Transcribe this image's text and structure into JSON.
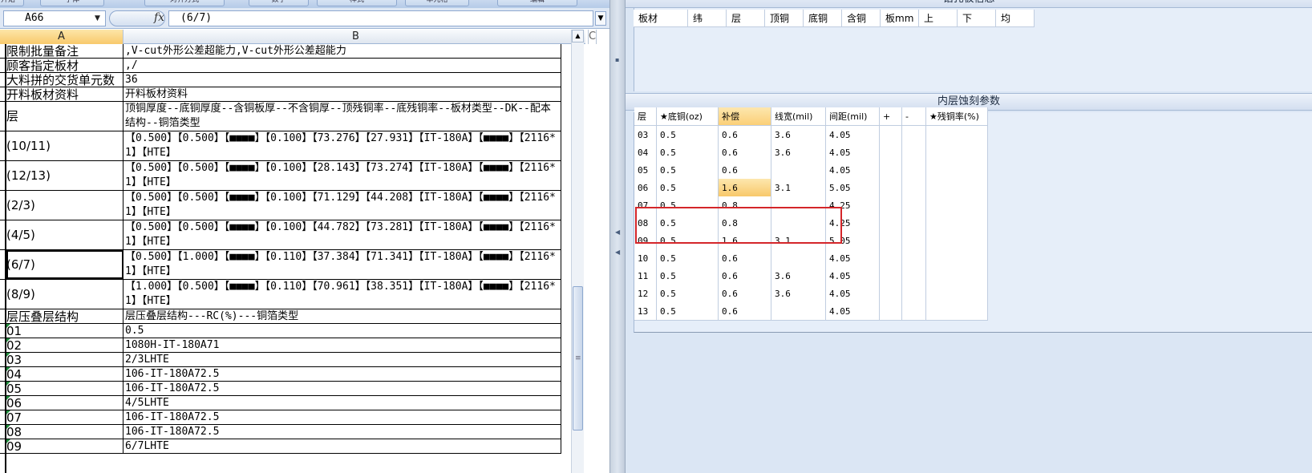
{
  "ribbon": {
    "tabs": [
      "开始",
      "字体",
      "对齐方式",
      "数字",
      "样式",
      "单元格",
      "编辑"
    ]
  },
  "formula_bar": {
    "name_box": "A66",
    "fx": "fx",
    "value": "(6/7)"
  },
  "columns": {
    "a": "A",
    "b": "B",
    "c": "C"
  },
  "sheet_rows": [
    {
      "a": "限制批量备注",
      "b": ",V-cut外形公差超能力,V-cut外形公差超能力"
    },
    {
      "a": "顾客指定板材",
      "b": ",/"
    },
    {
      "a": "大料拼的交货单元数",
      "b": "36"
    },
    {
      "a": "开料板材资料",
      "b": "开料板材资料"
    },
    {
      "a": "层",
      "b": "顶铜厚度--底铜厚度--含铜板厚--不含铜厚--顶残铜率--底残铜率--板材类型--DK--配本结构--铜箔类型"
    },
    {
      "a": "(10/11)",
      "b": "【0.500】【0.500】【■■■■】【0.100】【73.276】【27.931】【IT-180A】【■■■■】【2116*1】【HTE】"
    },
    {
      "a": "(12/13)",
      "b": "【0.500】【0.500】【■■■■】【0.100】【28.143】【73.274】【IT-180A】【■■■■】【2116*1】【HTE】"
    },
    {
      "a": "(2/3)",
      "b": "【0.500】【0.500】【■■■■】【0.100】【71.129】【44.208】【IT-180A】【■■■■】【2116*1】【HTE】"
    },
    {
      "a": "(4/5)",
      "b": "【0.500】【0.500】【■■■■】【0.100】【44.782】【73.281】【IT-180A】【■■■■】【2116*1】【HTE】"
    },
    {
      "a": "(6/7)",
      "b": "【0.500】【1.000】【■■■■】【0.110】【37.384】【71.341】【IT-180A】【■■■■】【2116*1】【HTE】"
    },
    {
      "a": "(8/9)",
      "b": "【1.000】【0.500】【■■■■】【0.110】【70.961】【38.351】【IT-180A】【■■■■】【2116*1】【HTE】"
    },
    {
      "a": "层压叠层结构",
      "b": "层压叠层结构---RC(%)---铜箔类型"
    },
    {
      "a": "01",
      "b": "0.5"
    },
    {
      "a": "02",
      "b": "1080H-IT-180A71"
    },
    {
      "a": "03",
      "b": "2/3LHTE"
    },
    {
      "a": "04",
      "b": "106-IT-180A72.5"
    },
    {
      "a": "05",
      "b": "106-IT-180A72.5"
    },
    {
      "a": "06",
      "b": "4/5LHTE"
    },
    {
      "a": "07",
      "b": "106-IT-180A72.5"
    },
    {
      "a": "08",
      "b": "106-IT-180A72.5"
    },
    {
      "a": "09",
      "b": "6/7LHTE"
    }
  ],
  "top_panel": {
    "title": "钻孔板信息",
    "headers": [
      "板材",
      "纬",
      "层",
      "顶铜",
      "底铜",
      "含铜",
      "板mm",
      "上",
      "下",
      "均"
    ]
  },
  "inner_panel": {
    "title": "内层蚀刻参数",
    "headers": [
      "层",
      "★底铜(oz)",
      "补偿",
      "线宽(mil)",
      "间距(mil)",
      "+",
      "-",
      "★残铜率(%)"
    ],
    "rows": [
      [
        "03",
        "0.5",
        "0.6",
        "3.6",
        "4.05",
        "",
        "",
        ""
      ],
      [
        "04",
        "0.5",
        "0.6",
        "3.6",
        "4.05",
        "",
        "",
        ""
      ],
      [
        "05",
        "0.5",
        "0.6",
        "",
        "4.05",
        "",
        "",
        ""
      ],
      [
        "06",
        "0.5",
        "1.6",
        "3.1",
        "5.05",
        "",
        "",
        ""
      ],
      [
        "07",
        "0.5",
        "0.8",
        "",
        "4.25",
        "",
        "",
        ""
      ],
      [
        "08",
        "0.5",
        "0.8",
        "",
        "4.25",
        "",
        "",
        ""
      ],
      [
        "09",
        "0.5",
        "1.6",
        "3.1",
        "5.05",
        "",
        "",
        ""
      ],
      [
        "10",
        "0.5",
        "0.6",
        "",
        "4.05",
        "",
        "",
        ""
      ],
      [
        "11",
        "0.5",
        "0.6",
        "3.6",
        "4.05",
        "",
        "",
        ""
      ],
      [
        "12",
        "0.5",
        "0.6",
        "3.6",
        "4.05",
        "",
        "",
        ""
      ],
      [
        "13",
        "0.5",
        "0.6",
        "",
        "4.05",
        "",
        "",
        ""
      ]
    ]
  },
  "colors": {
    "highlight": "#fbcf77",
    "red_box": "#d4262a",
    "panel_bg": "#dbe6f4"
  }
}
